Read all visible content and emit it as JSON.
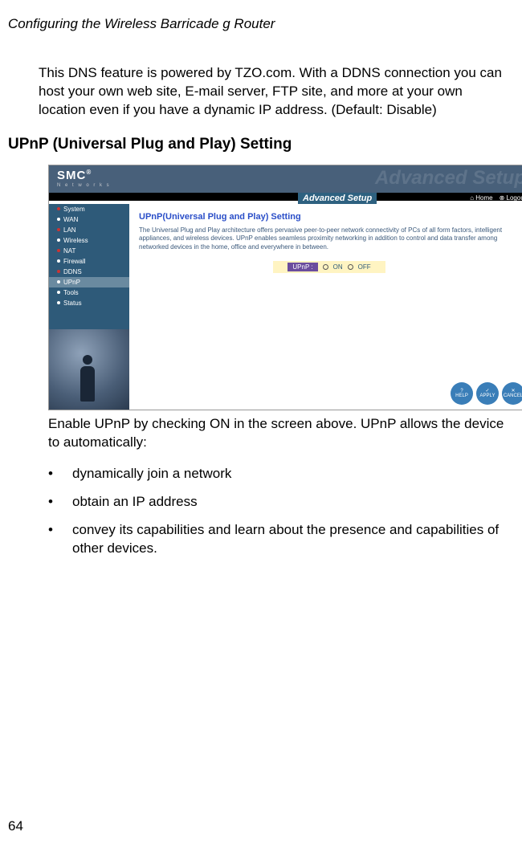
{
  "header": {
    "title": "Configuring the Wireless Barricade g Router"
  },
  "intro": "This DNS feature is powered by TZO.com. With a DDNS connection you can host your own web site, E-mail server, FTP site, and more at your own location even if you have a dynamic IP address. (Default: Disable)",
  "section_heading": "UPnP (Universal Plug and Play) Setting",
  "screenshot": {
    "logo": "SMC",
    "logo_reg": "®",
    "logo_sub": "N e t w o r k s",
    "watermark": "Advanced Setup",
    "tab_label": "Advanced Setup",
    "home": "Home",
    "logout": "Logout",
    "sidebar": [
      "System",
      "WAN",
      "LAN",
      "Wireless",
      "NAT",
      "Firewall",
      "DDNS",
      "UPnP",
      "Tools",
      "Status"
    ],
    "sidebar_selected_index": 7,
    "content_heading": "UPnP(Universal Plug and Play) Setting",
    "content_desc": "The Universal Plug and Play architecture offers pervasive peer-to-peer network connectivity of PCs of all form factors, intelligent appliances, and wireless devices. UPnP enables seamless proximity networking in addition to control and data transfer among networked devices in the home, office and everywhere in between.",
    "upnp_label": "UPnP :",
    "on": "ON",
    "off": "OFF",
    "round_buttons": [
      "HELP",
      "APPLY",
      "CANCEL"
    ]
  },
  "after_screenshot": "Enable UPnP by checking ON in the screen above. UPnP allows the device to automatically:",
  "bullets": [
    "dynamically join a network",
    "obtain an IP address",
    "convey its capabilities and learn about the presence and capabilities of other devices."
  ],
  "page_number": "64"
}
